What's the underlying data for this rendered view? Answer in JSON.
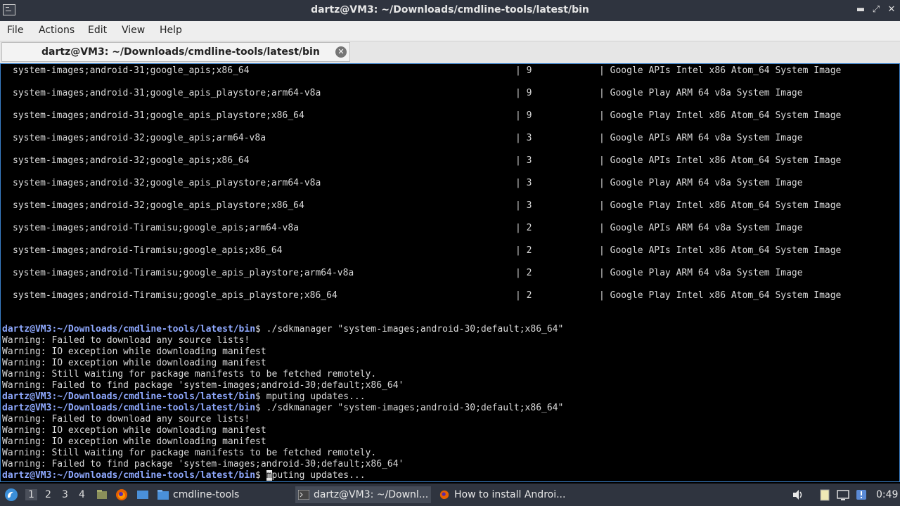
{
  "window": {
    "title": "dartz@VM3: ~/Downloads/cmdline-tools/latest/bin",
    "minimize": "▬",
    "maximize": "⤢",
    "close": "✕"
  },
  "menu": {
    "file": "File",
    "actions": "Actions",
    "edit": "Edit",
    "view": "View",
    "help": "Help"
  },
  "tab": {
    "label": "dartz@VM3: ~/Downloads/cmdline-tools/latest/bin",
    "close_icon": "close-icon"
  },
  "terminal": {
    "package_rows": [
      {
        "path": "system-images;android-31;google_apis;x86_64",
        "version": "9",
        "description": "Google APIs Intel x86 Atom_64 System Image"
      },
      {
        "path": "system-images;android-31;google_apis_playstore;arm64-v8a",
        "version": "9",
        "description": "Google Play ARM 64 v8a System Image"
      },
      {
        "path": "system-images;android-31;google_apis_playstore;x86_64",
        "version": "9",
        "description": "Google Play Intel x86 Atom_64 System Image"
      },
      {
        "path": "system-images;android-32;google_apis;arm64-v8a",
        "version": "3",
        "description": "Google APIs ARM 64 v8a System Image"
      },
      {
        "path": "system-images;android-32;google_apis;x86_64",
        "version": "3",
        "description": "Google APIs Intel x86 Atom_64 System Image"
      },
      {
        "path": "system-images;android-32;google_apis_playstore;arm64-v8a",
        "version": "3",
        "description": "Google Play ARM 64 v8a System Image"
      },
      {
        "path": "system-images;android-32;google_apis_playstore;x86_64",
        "version": "3",
        "description": "Google Play Intel x86 Atom_64 System Image"
      },
      {
        "path": "system-images;android-Tiramisu;google_apis;arm64-v8a",
        "version": "2",
        "description": "Google APIs ARM 64 v8a System Image"
      },
      {
        "path": "system-images;android-Tiramisu;google_apis;x86_64",
        "version": "2",
        "description": "Google APIs Intel x86 Atom_64 System Image"
      },
      {
        "path": "system-images;android-Tiramisu;google_apis_playstore;arm64-v8a",
        "version": "2",
        "description": "Google Play ARM 64 v8a System Image"
      },
      {
        "path": "system-images;android-Tiramisu;google_apis_playstore;x86_64",
        "version": "2",
        "description": "Google Play Intel x86 Atom_64 System Image"
      }
    ],
    "prompt": "dartz@VM3:~/Downloads/cmdline-tools/latest/bin",
    "output_lines": [
      {
        "prompt": true,
        "text": "$ ./sdkmanager \"system-images;android-30;default;x86_64\""
      },
      {
        "prompt": false,
        "text": "Warning: Failed to download any source lists!"
      },
      {
        "prompt": false,
        "text": "Warning: IO exception while downloading manifest"
      },
      {
        "prompt": false,
        "text": "Warning: IO exception while downloading manifest"
      },
      {
        "prompt": false,
        "text": "Warning: Still waiting for package manifests to be fetched remotely."
      },
      {
        "prompt": false,
        "text": "Warning: Failed to find package 'system-images;android-30;default;x86_64'"
      },
      {
        "prompt": true,
        "text": "$ mputing updates..."
      },
      {
        "prompt": true,
        "text": "$ ./sdkmanager \"system-images;android-30;default;x86_64\""
      },
      {
        "prompt": false,
        "text": "Warning: Failed to download any source lists!"
      },
      {
        "prompt": false,
        "text": "Warning: IO exception while downloading manifest"
      },
      {
        "prompt": false,
        "text": "Warning: IO exception while downloading manifest"
      },
      {
        "prompt": false,
        "text": "Warning: Still waiting for package manifests to be fetched remotely."
      },
      {
        "prompt": false,
        "text": "Warning: Failed to find package 'system-images;android-30;default;x86_64'"
      }
    ],
    "last_line": {
      "cursor_char": "m",
      "rest": "puting updates..."
    }
  },
  "taskbar": {
    "workspaces": [
      "1",
      "2",
      "3",
      "4"
    ],
    "tasks": {
      "files": "cmdline-tools",
      "terminal": "dartz@VM3: ~/Downl...",
      "browser": "How to install Androi..."
    },
    "clock": "0:49"
  },
  "colors": {
    "prompt": "#8fa9ff",
    "terminal_bg": "#000000",
    "titlebar_bg": "#2f343f",
    "terminal_border": "#3a80c9"
  }
}
